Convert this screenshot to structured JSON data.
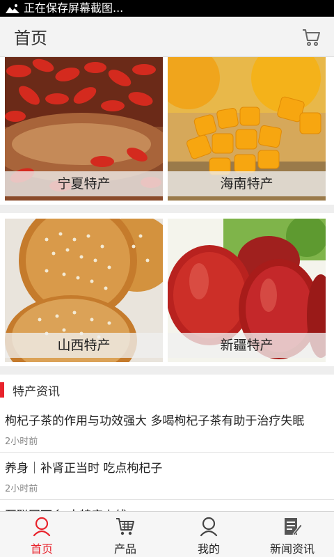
{
  "status_bar": {
    "text": "正在保存屏幕截图..."
  },
  "header": {
    "title": "首页",
    "cart_icon": "cart-icon"
  },
  "categories": [
    {
      "label": "宁夏特产",
      "image": "goji-berries"
    },
    {
      "label": "海南特产",
      "image": "mango"
    },
    {
      "label": "山西特产",
      "image": "sesame-cakes"
    },
    {
      "label": "新疆特产",
      "image": "red-dates"
    }
  ],
  "news": {
    "heading": "特产资讯",
    "accent": "#e8232c",
    "items": [
      {
        "title": "枸杞子茶的作用与功效强大 多喝枸杞子茶有助于治疗失眠",
        "time": "2小时前"
      },
      {
        "title": "养身｜补肾正当时 吃点枸杞子",
        "time": "2小时前"
      },
      {
        "title": "互联网下乡 土特产上线",
        "time": ""
      }
    ]
  },
  "tabbar": {
    "active_color": "#e8232c",
    "items": [
      {
        "label": "首页",
        "icon": "home-icon",
        "active": true
      },
      {
        "label": "产品",
        "icon": "cart-icon",
        "active": false
      },
      {
        "label": "我的",
        "icon": "user-icon",
        "active": false
      },
      {
        "label": "新闻资讯",
        "icon": "news-icon",
        "active": false
      }
    ]
  }
}
